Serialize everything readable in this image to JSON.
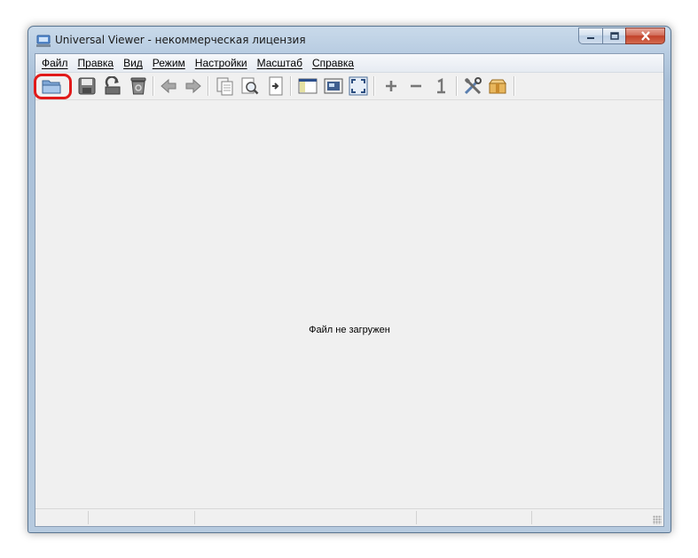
{
  "window": {
    "title": "Universal Viewer - некоммерческая лицензия"
  },
  "menu": {
    "items": [
      "Файл",
      "Правка",
      "Вид",
      "Режим",
      "Настройки",
      "Масштаб",
      "Справка"
    ]
  },
  "toolbar": {
    "buttons": [
      {
        "icon": "open-folder-icon"
      },
      {
        "icon": "save-icon"
      },
      {
        "icon": "reload-icon"
      },
      {
        "icon": "recycle-bin-icon"
      },
      {
        "icon": "arrow-left-icon"
      },
      {
        "icon": "arrow-right-icon"
      },
      {
        "icon": "copy-icon"
      },
      {
        "icon": "find-icon"
      },
      {
        "icon": "goto-icon"
      },
      {
        "icon": "panel-icon"
      },
      {
        "icon": "show-image-icon"
      },
      {
        "icon": "fullscreen-icon"
      },
      {
        "icon": "zoom-in-icon",
        "label": "+"
      },
      {
        "icon": "zoom-out-icon",
        "label": "−"
      },
      {
        "icon": "actual-size-icon",
        "label": "1"
      },
      {
        "icon": "tools-icon"
      },
      {
        "icon": "package-icon"
      }
    ],
    "highlight_color": "#e11a1a"
  },
  "content": {
    "message": "Файл не загружен"
  }
}
